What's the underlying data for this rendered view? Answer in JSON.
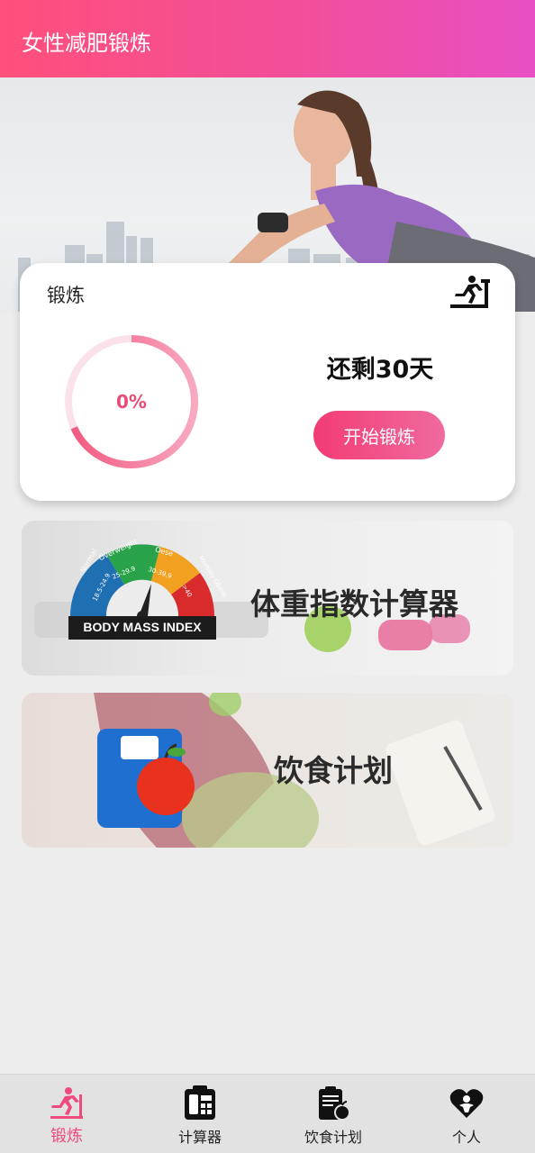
{
  "app": {
    "title": "女性减肥锻炼"
  },
  "workout": {
    "title": "锻炼",
    "progress_text": "0%",
    "progress": 0,
    "days_left": "还剩30天",
    "start_label": "开始锻炼"
  },
  "features": {
    "bmi": {
      "title": "体重指数计算器",
      "badge": "BODY MASS INDEX",
      "segments": [
        "Normal",
        "Overweight",
        "Oese",
        "Morbidy Obese"
      ],
      "ranges": [
        "18.5-24.9",
        "25-29.9",
        "30-39.9",
        ">40"
      ]
    },
    "diet": {
      "title": "饮食计划"
    }
  },
  "nav": {
    "items": [
      {
        "label": "锻炼",
        "icon": "runner-icon"
      },
      {
        "label": "计算器",
        "icon": "calculator-icon"
      },
      {
        "label": "饮食计划",
        "icon": "diet-plan-icon"
      },
      {
        "label": "个人",
        "icon": "heart-person-icon"
      }
    ]
  },
  "colors": {
    "primary": "#ef4a7c",
    "header_start": "#ff4f7b",
    "header_end": "#e84fc4"
  }
}
